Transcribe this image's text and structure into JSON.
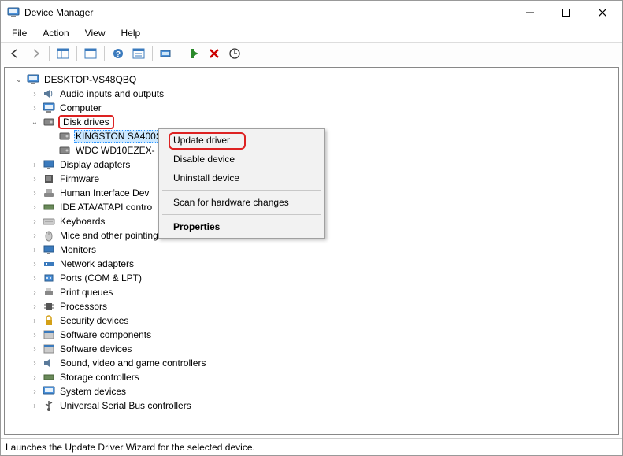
{
  "window": {
    "title": "Device Manager"
  },
  "menubar": [
    "File",
    "Action",
    "View",
    "Help"
  ],
  "tree": {
    "root": "DESKTOP-VS48QBQ",
    "categories": [
      "Audio inputs and outputs",
      "Computer",
      "Disk drives",
      "Display adapters",
      "Firmware",
      "Human Interface Devices",
      "IDE ATA/ATAPI controllers",
      "Keyboards",
      "Mice and other pointing devices",
      "Monitors",
      "Network adapters",
      "Ports (COM & LPT)",
      "Print queues",
      "Processors",
      "Security devices",
      "Software components",
      "Software devices",
      "Sound, video and game controllers",
      "Storage controllers",
      "System devices",
      "Universal Serial Bus controllers"
    ],
    "disk_drives": {
      "label": "Disk drives",
      "children": [
        "KINGSTON SA400S",
        "WDC WD10EZEX-"
      ]
    }
  },
  "hid_truncated": "Human Interface Dev",
  "ide_truncated": "IDE ATA/ATAPI contro",
  "context_menu": {
    "items": [
      "Update driver",
      "Disable device",
      "Uninstall device",
      "Scan for hardware changes",
      "Properties"
    ]
  },
  "statusbar": "Launches the Update Driver Wizard for the selected device."
}
